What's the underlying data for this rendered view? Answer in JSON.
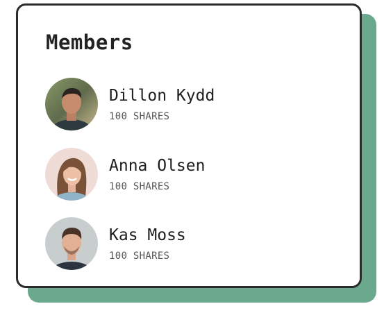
{
  "card": {
    "title": "Members"
  },
  "members": [
    {
      "name": "Dillon Kydd",
      "shares": "100 SHARES"
    },
    {
      "name": "Anna Olsen",
      "shares": "100 SHARES"
    },
    {
      "name": "Kas Moss",
      "shares": "100 SHARES"
    }
  ],
  "colors": {
    "shadow_accent": "#6aa98e",
    "border": "#2b2b2b"
  }
}
